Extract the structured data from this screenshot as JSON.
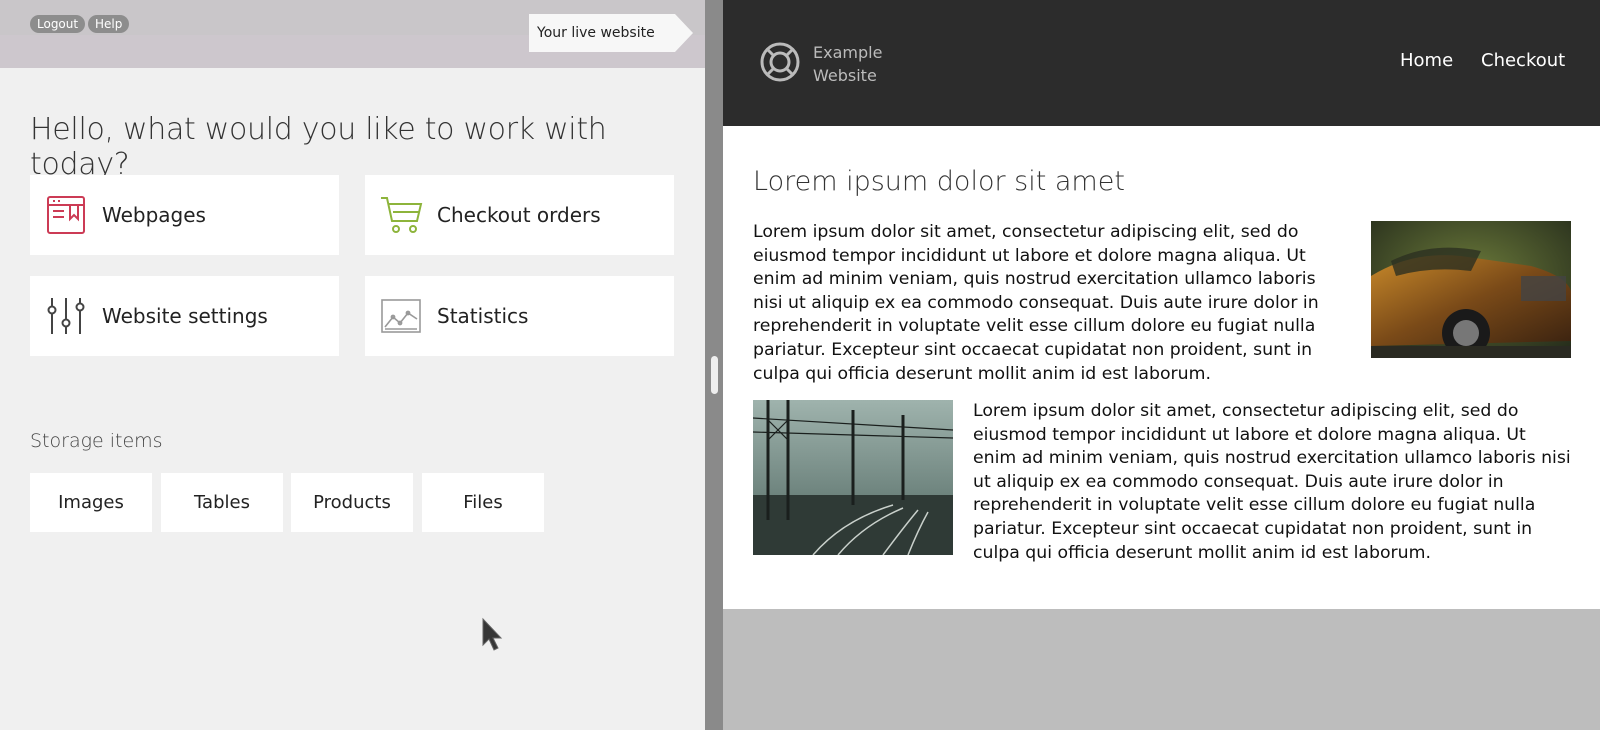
{
  "admin": {
    "logout_label": "Logout",
    "help_label": "Help",
    "live_website_label": "Your live website",
    "greeting": "Hello, what would you like to work with today?",
    "tiles": [
      {
        "label": "Webpages",
        "icon": "webpage-icon",
        "color": "#cc3b55"
      },
      {
        "label": "Checkout orders",
        "icon": "cart-icon",
        "color": "#8db43b"
      },
      {
        "label": "Website settings",
        "icon": "sliders-icon",
        "color": "#444444"
      },
      {
        "label": "Statistics",
        "icon": "chart-icon",
        "color": "#999999"
      }
    ],
    "storage_title": "Storage items",
    "storage_items": [
      "Images",
      "Tables",
      "Products",
      "Files"
    ]
  },
  "site": {
    "logo_line1": "Example",
    "logo_line2": "Website",
    "nav": [
      "Home",
      "Checkout"
    ],
    "title": "Lorem ipsum dolor sit amet",
    "paragraph1": "Lorem ipsum dolor sit amet, consectetur adipiscing elit, sed do eiusmod tempor incididunt ut labore et dolore magna aliqua. Ut enim ad minim veniam, quis nostrud exercitation ullamco laboris nisi ut aliquip ex ea commodo consequat. Duis aute irure dolor in reprehenderit in voluptate velit esse cillum dolore eu fugiat nulla pariatur. Excepteur sint occaecat cupidatat non proident, sunt in culpa qui officia deserunt mollit anim id est laborum.",
    "paragraph2": "Lorem ipsum dolor sit amet, consectetur adipiscing elit, sed do eiusmod tempor incididunt ut labore et dolore magna aliqua. Ut enim ad minim veniam, quis nostrud exercitation ullamco laboris nisi ut aliquip ex ea commodo consequat. Duis aute irure dolor in reprehenderit in voluptate velit esse cillum dolore eu fugiat nulla pariatur. Excepteur sint occaecat cupidatat non proident, sunt in culpa qui officia deserunt mollit anim id est laborum."
  },
  "colors": {
    "admin_bg": "#f0f0f0",
    "site_header_bg": "#2c2c2c",
    "divider": "#8a8a8a"
  }
}
